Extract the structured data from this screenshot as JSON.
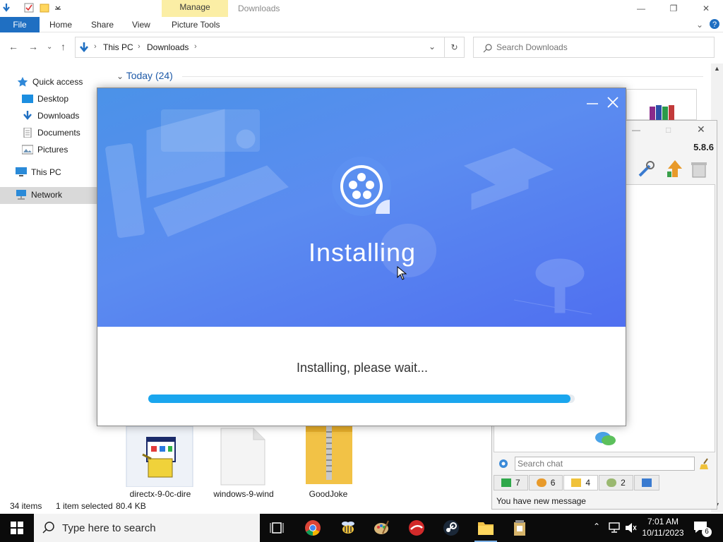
{
  "explorer": {
    "title": "Downloads",
    "manage_tab": "Manage",
    "ribbon_tabs": {
      "file": "File",
      "home": "Home",
      "share": "Share",
      "view": "View",
      "picture_tools": "Picture Tools"
    },
    "breadcrumb": [
      "This PC",
      "Downloads"
    ],
    "search_placeholder": "Search Downloads",
    "nav": {
      "quick_access": "Quick access",
      "desktop": "Desktop",
      "downloads": "Downloads",
      "documents": "Documents",
      "pictures": "Pictures",
      "this_pc": "This PC",
      "network": "Network"
    },
    "group_header": "Today (24)",
    "files": [
      {
        "name": "directx-9-0c-dire",
        "icon": "setup-installer-icon"
      },
      {
        "name": "windows-9-wind",
        "icon": "blank-file-icon"
      },
      {
        "name": "GoodJoke",
        "icon": "zip-folder-icon"
      }
    ],
    "status": {
      "items": "34 items",
      "selected": "1 item selected",
      "size": "80.4 KB"
    }
  },
  "installer": {
    "hero_title": "Installing",
    "wait_text": "Installing, please wait...",
    "progress": 0.99,
    "accent": "#1aa6ee"
  },
  "chat": {
    "version": "5.8.6",
    "search_placeholder": "Search chat",
    "tabs": [
      {
        "count": "7"
      },
      {
        "count": "6"
      },
      {
        "count": "4"
      },
      {
        "count": "2"
      },
      {
        "count": ""
      }
    ],
    "message": "You have new message"
  },
  "taskbar": {
    "search_placeholder": "Type here to search",
    "time": "7:01 AM",
    "date": "10/11/2023",
    "notification_count": "6"
  }
}
